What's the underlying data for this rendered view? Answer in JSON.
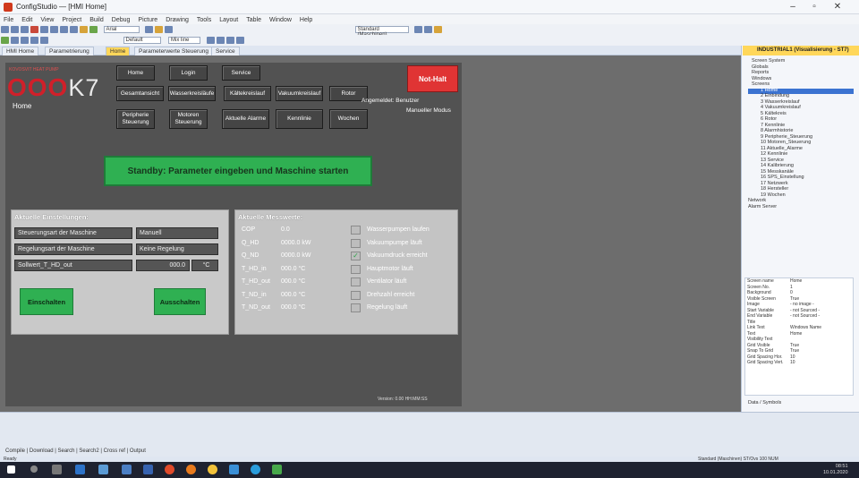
{
  "window": {
    "title": "ConfigStudio — [HMI Home]"
  },
  "menu": [
    "File",
    "Edit",
    "View",
    "Project",
    "Build",
    "Debug",
    "Picture",
    "Drawing",
    "Tools",
    "Layout",
    "Table",
    "Window",
    "Help"
  ],
  "toolbar": {
    "font_value": "Default",
    "field1": "Arial",
    "field2": "Mix line",
    "field3": "Standard (Maschinen)"
  },
  "doc_tabs": [
    "HMI Home",
    "Parametrierung",
    "Home",
    "Parameterwerte Steuerung",
    "Service"
  ],
  "hmi": {
    "logo_main": "OOO",
    "logo_k7": "K7",
    "logo_sub": "KOVOSVIT HEAT PUMP",
    "page_label": "Home",
    "nav_row1": [
      "Home",
      "Login",
      "Service"
    ],
    "nav_row2": [
      "Gesamtansicht",
      "Wasserkreisläufe",
      "Kältekreislauf",
      "Vakuumkreislauf",
      "Rotor"
    ],
    "nav_row3": [
      "Peripherie Steuerung",
      "Motoren Steuerung",
      "Aktuelle Alarme",
      "Kennlinie",
      "Wochen"
    ],
    "nothalt": "Not-Halt",
    "angemeldet": "Angemeldet: Benutzer",
    "manuell": "Manueller Modus",
    "status": "Standby: Parameter eingeben und Maschine starten",
    "settings": {
      "title": "Aktuelle Einstellungen:",
      "rows": [
        {
          "label": "Steuerungsart der Maschine",
          "value": "Manuell"
        },
        {
          "label": "Regelungsart der Maschine",
          "value": "Keine Regelung"
        },
        {
          "label": "Sollwert_T_HD_out",
          "value": "000.0",
          "unit": "°C"
        }
      ],
      "on_label": "Einschalten",
      "off_label": "Ausschalten"
    },
    "measurements": {
      "title": "Aktuelle Messwerte:",
      "rows": [
        {
          "name": "COP",
          "value": "0.0"
        },
        {
          "name": "Q_HD",
          "value": "0000.0 kW"
        },
        {
          "name": "Q_ND",
          "value": "0000.0 kW"
        },
        {
          "name": "T_HD_in",
          "value": "000.0 °C"
        },
        {
          "name": "T_HD_out",
          "value": "000.0 °C"
        },
        {
          "name": "T_ND_in",
          "value": "000.0 °C"
        },
        {
          "name": "T_ND_out",
          "value": "000.0 °C"
        }
      ],
      "status": [
        {
          "label": "Wasserpumpen laufen",
          "checked": false
        },
        {
          "label": "Vakuumpumpe läuft",
          "checked": false
        },
        {
          "label": "Vakuumdruck erreicht",
          "checked": true
        },
        {
          "label": "Hauptmotor läuft",
          "checked": false
        },
        {
          "label": "Ventilator läuft",
          "checked": false
        },
        {
          "label": "Drehzahl erreicht",
          "checked": false
        },
        {
          "label": "Regelung läuft",
          "checked": false
        }
      ]
    },
    "version": "Version: 0.00   HH:MM:SS"
  },
  "right_pane": {
    "title": "INDUSTRIAL1 (Visualisierung - ST7)",
    "tree": [
      "Screen System",
      "Globals",
      "Reports",
      "Windows",
      "Screens",
      "1 Home",
      "2 Einbindung",
      "3 Wasserkreislauf",
      "4 Vakuumkreislauf",
      "5 Kältekreis",
      "6 Rotor",
      "7 Kennlinie",
      "8 Alarmhistorie",
      "9 Peripherie_Steuerung",
      "10 Motoren_Steuerung",
      "11 Aktuelle_Alarme",
      "12 Kennlinie",
      "13 Service",
      "14 Kalibrierung",
      "15 Messkanäle",
      "16 SPS_Einstellung",
      "17 Netzwerk",
      "18 Hersteller",
      "19 Wochen",
      "Network",
      "Alarm Server"
    ],
    "properties": [
      {
        "k": "Screen name",
        "v": "Home"
      },
      {
        "k": "Screen No.",
        "v": "1"
      },
      {
        "k": "Background",
        "v": "0"
      },
      {
        "k": "Visible Screen",
        "v": "True"
      },
      {
        "k": "Image",
        "v": "- no image -"
      },
      {
        "k": "Start Variable",
        "v": "- not Sourced -"
      },
      {
        "k": "End Variable",
        "v": "- not Sourced -"
      },
      {
        "k": "Title",
        "v": ""
      },
      {
        "k": "Link Text",
        "v": "Windows Name"
      },
      {
        "k": "Text",
        "v": "Home"
      },
      {
        "k": "Visibility Text",
        "v": ""
      },
      {
        "k": "Grid Visible",
        "v": "True"
      },
      {
        "k": "Snap To Grid",
        "v": "True"
      },
      {
        "k": "Grid Spacing Hor.",
        "v": "10"
      },
      {
        "k": "Grid Spacing Vert.",
        "v": "10"
      }
    ],
    "tabs": [
      "Data",
      "Symbols"
    ]
  },
  "output_tabs": "Compile | Download | Search | Search2 | Cross ref | Output",
  "statusline": {
    "left": "Ready",
    "right": "Standard (Maschinen)   ST/Ovs  100   NUM"
  },
  "taskbar": {
    "time": "08:51",
    "date": "10.01.2020"
  }
}
